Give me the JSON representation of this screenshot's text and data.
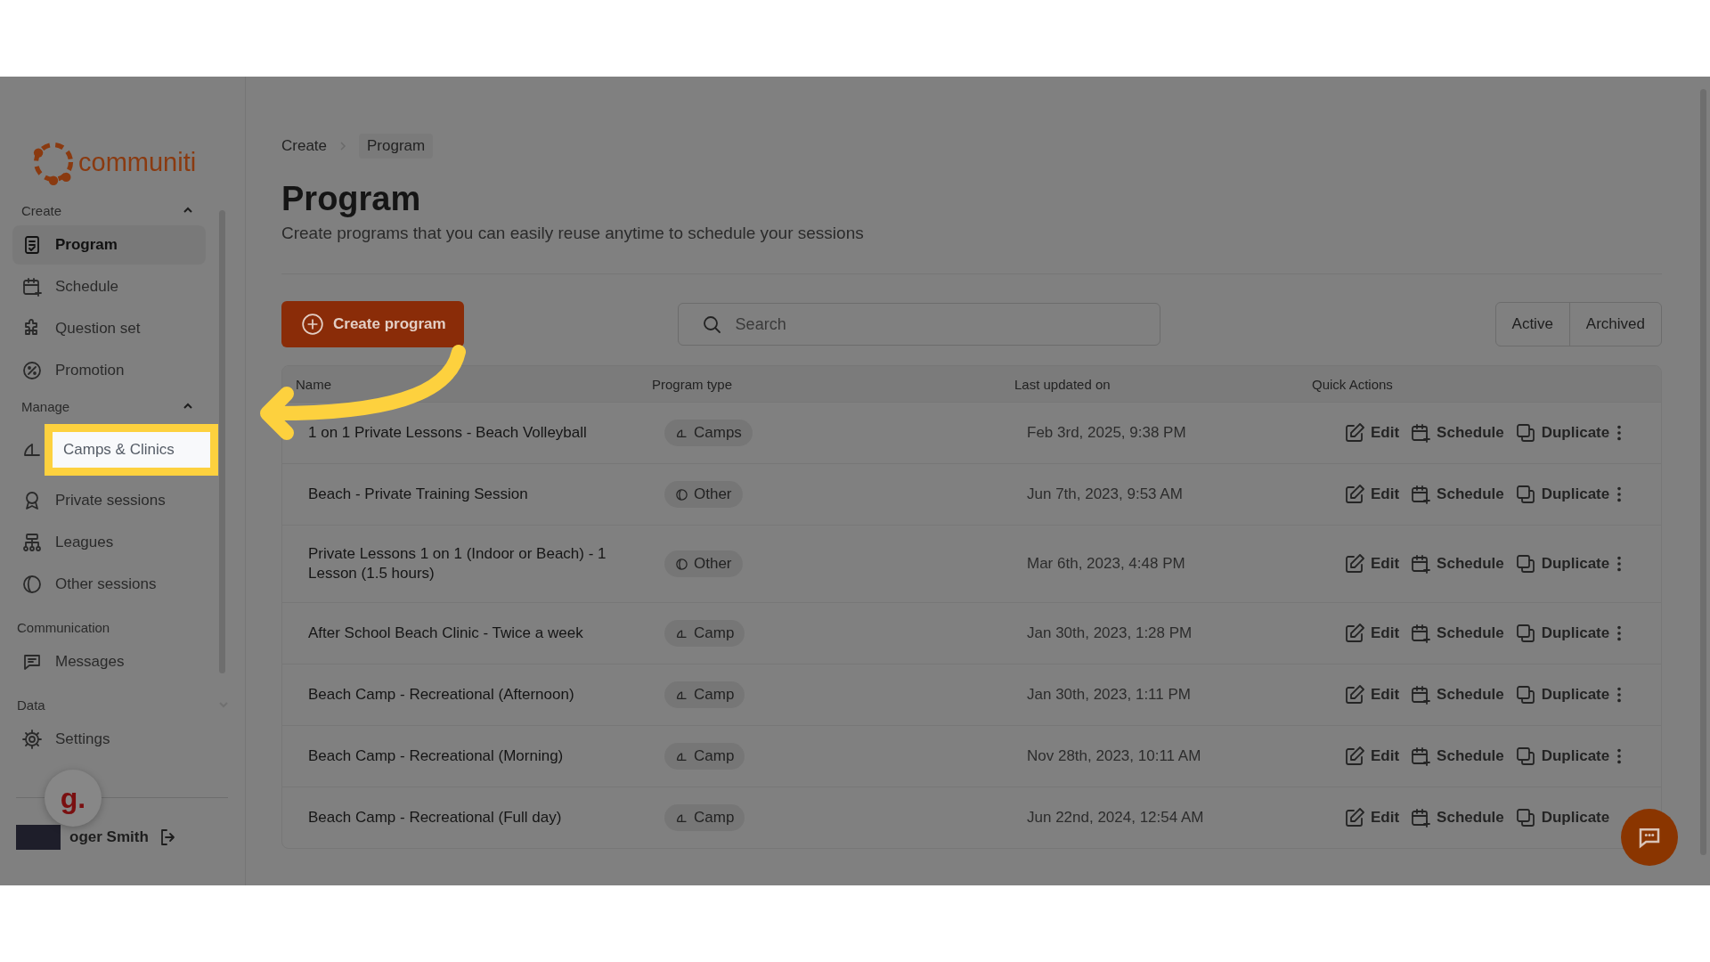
{
  "logo": {
    "text": "communiti"
  },
  "sidebar": {
    "sections": [
      {
        "title": "Create",
        "expanded": true,
        "items": [
          {
            "label": "Program",
            "selected": true
          },
          {
            "label": "Schedule",
            "selected": false
          },
          {
            "label": "Question set",
            "selected": false
          },
          {
            "label": "Promotion",
            "selected": false
          }
        ]
      },
      {
        "title": "Manage",
        "expanded": true,
        "items": [
          {
            "label": "Camps & Clinics",
            "selected": false,
            "highlighted": true
          },
          {
            "label": "Private sessions",
            "selected": false
          },
          {
            "label": "Leagues",
            "selected": false
          },
          {
            "label": "Other sessions",
            "selected": false
          }
        ]
      },
      {
        "title": "Communication",
        "items": [
          {
            "label": "Messages",
            "selected": false
          }
        ]
      },
      {
        "title": "Data",
        "expanded": false,
        "items": [
          {
            "label": "Settings",
            "selected": false
          }
        ]
      }
    ],
    "user": {
      "name": "oger Smith"
    }
  },
  "widget_badge": "g.",
  "breadcrumb": [
    "Create",
    "Program"
  ],
  "page": {
    "title": "Program",
    "subtitle": "Create programs that you can easily reuse anytime to schedule your sessions"
  },
  "toolbar": {
    "create_button": "Create program",
    "search": {
      "placeholder": "Search"
    },
    "filters": [
      {
        "label": "Active",
        "selected": false
      },
      {
        "label": "Archived",
        "selected": false
      }
    ]
  },
  "table": {
    "columns": [
      "Name",
      "Program type",
      "Last updated on",
      "Quick Actions"
    ],
    "rows": [
      {
        "name": "1 on 1 Private Lessons - Beach Volleyball",
        "type": {
          "label": "Camps",
          "kind": "camp"
        },
        "updated": "Feb 3rd, 2025, 9:38 PM",
        "actions": [
          "Edit",
          "Schedule",
          "Duplicate"
        ]
      },
      {
        "name": "Beach - Private Training Session",
        "type": {
          "label": "Other",
          "kind": "other"
        },
        "updated": "Jun 7th, 2023, 9:53 AM",
        "actions": [
          "Edit",
          "Schedule",
          "Duplicate"
        ]
      },
      {
        "name": "Private Lessons 1 on 1 (Indoor or Beach) - 1 Lesson (1.5 hours)",
        "type": {
          "label": "Other",
          "kind": "other"
        },
        "updated": "Mar 6th, 2023, 4:48 PM",
        "actions": [
          "Edit",
          "Schedule",
          "Duplicate"
        ]
      },
      {
        "name": "After School Beach Clinic - Twice a week",
        "type": {
          "label": "Camp",
          "kind": "camp"
        },
        "updated": "Jan 30th, 2023, 1:28 PM",
        "actions": [
          "Edit",
          "Schedule",
          "Duplicate"
        ]
      },
      {
        "name": "Beach Camp - Recreational (Afternoon)",
        "type": {
          "label": "Camp",
          "kind": "camp"
        },
        "updated": "Jan 30th, 2023, 1:11 PM",
        "actions": [
          "Edit",
          "Schedule",
          "Duplicate"
        ]
      },
      {
        "name": "Beach Camp - Recreational (Morning)",
        "type": {
          "label": "Camp",
          "kind": "camp"
        },
        "updated": "Nov 28th, 2023, 10:11 AM",
        "actions": [
          "Edit",
          "Schedule",
          "Duplicate"
        ]
      },
      {
        "name": "Beach Camp - Recreational (Full day)",
        "type": {
          "label": "Camp",
          "kind": "camp"
        },
        "updated": "Jun 22nd, 2024, 12:54 AM",
        "actions": [
          "Edit",
          "Schedule",
          "Duplicate"
        ]
      }
    ]
  }
}
